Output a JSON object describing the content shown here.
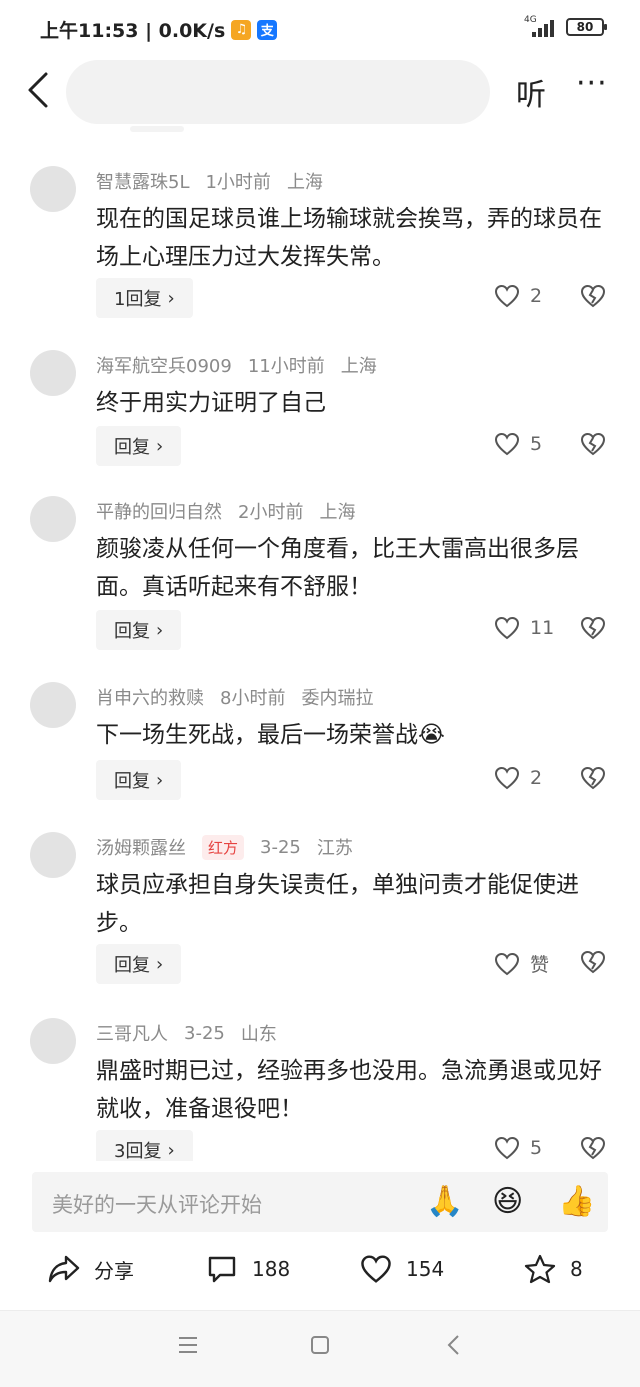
{
  "status_bar": {
    "time_speed": "上午11:53 | 0.0K/s",
    "app_badge_1": "♫",
    "app_badge_2": "支",
    "network": "4G",
    "battery": "80"
  },
  "topbar": {
    "listen_label": "听",
    "more_label": "···"
  },
  "comments": [
    {
      "user": "智慧露珠5L",
      "time": "1小时前",
      "location": "上海",
      "tag": "",
      "text": "现在的国足球员谁上场输球就会挨骂，弄的球员在场上心理压力过大发挥失常。",
      "reply_label": "1回复",
      "likes": "2"
    },
    {
      "user": "海军航空兵0909",
      "time": "11小时前",
      "location": "上海",
      "tag": "",
      "text": "终于用实力证明了自己",
      "reply_label": "回复",
      "likes": "5"
    },
    {
      "user": "平静的回归自然",
      "time": "2小时前",
      "location": "上海",
      "tag": "",
      "text": "颜骏凌从任何一个角度看，比王大雷高出很多层面。真话听起来有不舒服！",
      "reply_label": "回复",
      "likes": "11"
    },
    {
      "user": "肖申六的救赎",
      "time": "8小时前",
      "location": "委内瑞拉",
      "tag": "",
      "text": "下一场生死战，最后一场荣誉战😭",
      "reply_label": "回复",
      "likes": "2"
    },
    {
      "user": "汤姆颗露丝",
      "time": "3-25",
      "location": "江苏",
      "tag": "红方",
      "text": "球员应承担自身失误责任，单独问责才能促使进步。",
      "reply_label": "回复",
      "likes": "赞"
    },
    {
      "user": "三哥凡人",
      "time": "3-25",
      "location": "山东",
      "tag": "",
      "text": "鼎盛时期已过，经验再多也没用。急流勇退或见好就收，准备退役吧！",
      "reply_label": "3回复",
      "likes": "5"
    }
  ],
  "input": {
    "placeholder": "美好的一天从评论开始",
    "emojis": [
      "🙏",
      "😆",
      "👍"
    ]
  },
  "actions": {
    "share_label": "分享",
    "comments_count": "188",
    "likes_count": "154",
    "favorites_count": "8"
  },
  "colors": {
    "tag_red": "#e64340",
    "text_meta": "#8a8a8a",
    "bg_light": "#f4f4f4"
  }
}
